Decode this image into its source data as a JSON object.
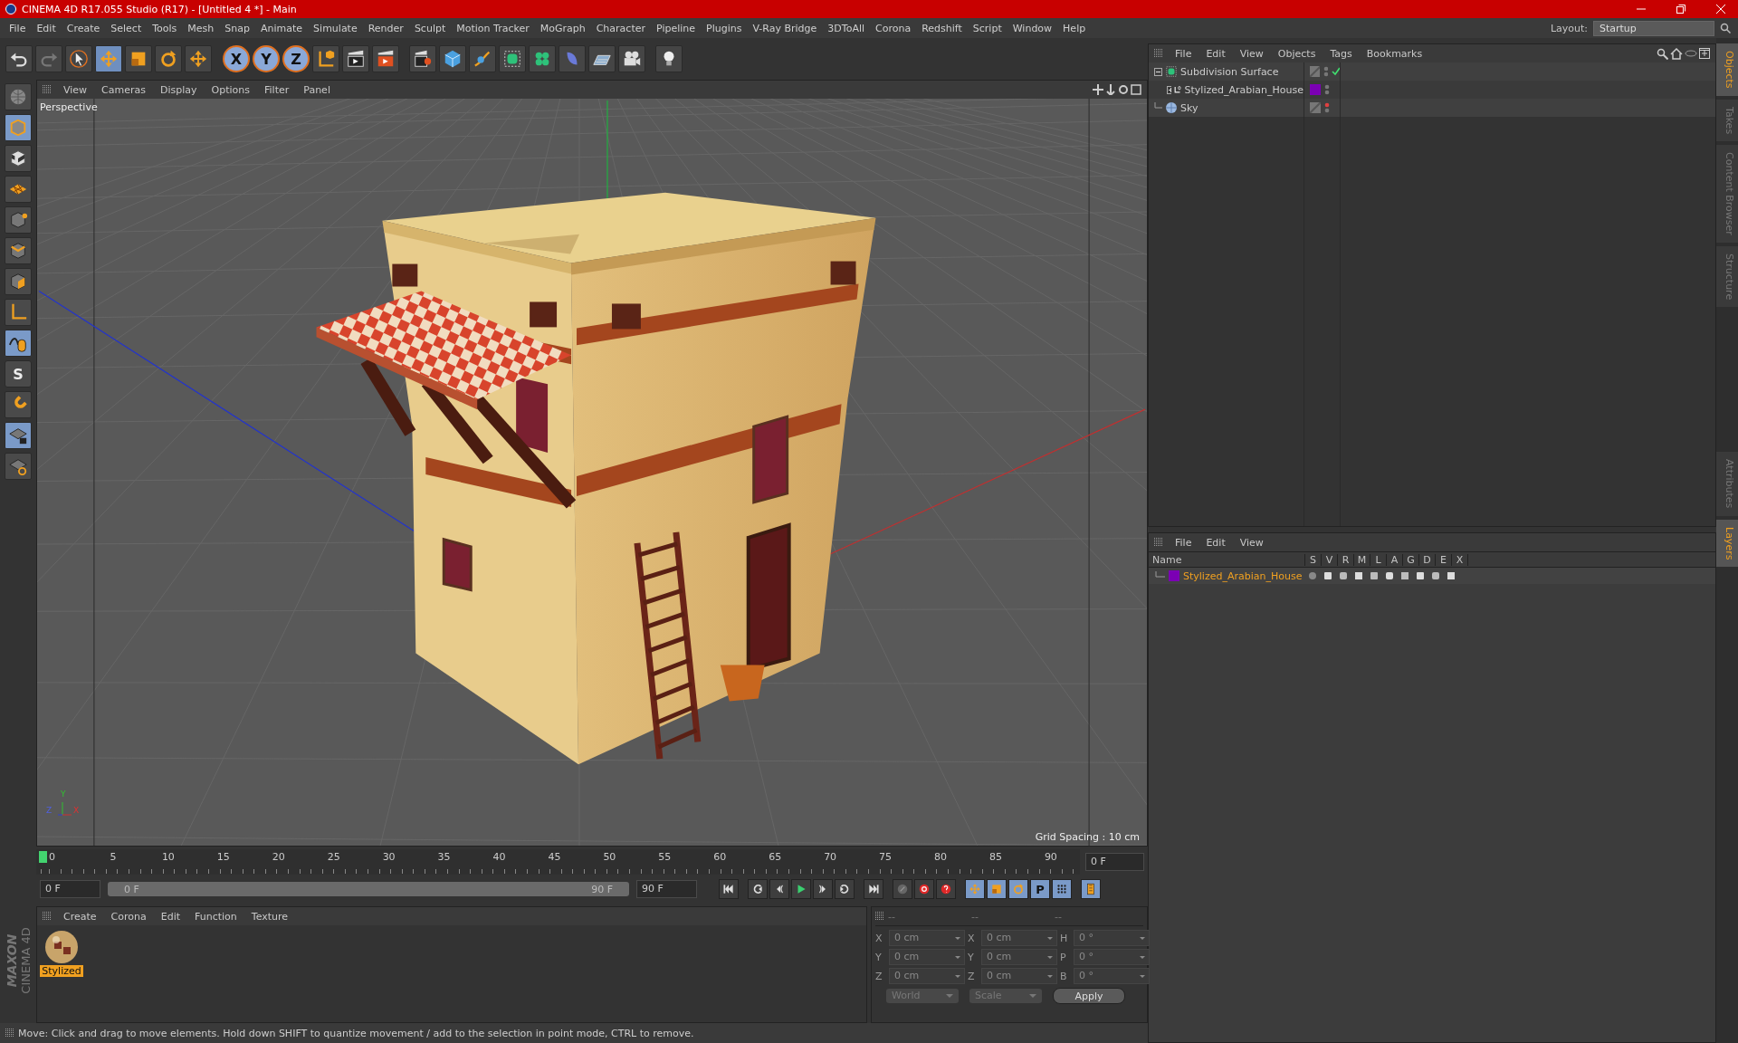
{
  "window": {
    "title": "CINEMA 4D R17.055 Studio (R17) - [Untitled 4 *] - Main"
  },
  "menu": [
    "File",
    "Edit",
    "Create",
    "Select",
    "Tools",
    "Mesh",
    "Snap",
    "Animate",
    "Simulate",
    "Render",
    "Sculpt",
    "Motion Tracker",
    "MoGraph",
    "Character",
    "Pipeline",
    "Plugins",
    "V-Ray Bridge",
    "3DToAll",
    "Corona",
    "Redshift",
    "Script",
    "Window",
    "Help"
  ],
  "layout": {
    "label": "Layout:",
    "value": "Startup"
  },
  "toolbar": {
    "axis_locks": [
      "X",
      "Y",
      "Z"
    ]
  },
  "left_palette": {
    "snap_letter": "S"
  },
  "viewport": {
    "menu": [
      "View",
      "Cameras",
      "Display",
      "Options",
      "Filter",
      "Panel"
    ],
    "camera": "Perspective",
    "grid_spacing": "Grid Spacing : 10 cm",
    "axes": [
      "Y",
      "Z",
      "X"
    ]
  },
  "timeline": {
    "ticks": [
      "0",
      "5",
      "10",
      "15",
      "20",
      "25",
      "30",
      "35",
      "40",
      "45",
      "50",
      "55",
      "60",
      "65",
      "70",
      "75",
      "80",
      "85",
      "90"
    ],
    "current_frame": "0 F",
    "start": "0 F",
    "range_start": "0 F",
    "range_end": "90 F",
    "range_slider": {
      "level": 1
    },
    "end": "90 F",
    "parameter_key": "P"
  },
  "material_manager": {
    "menu": [
      "Create",
      "Corona",
      "Edit",
      "Function",
      "Texture"
    ],
    "materials": [
      {
        "name": "Stylized",
        "selected": true
      }
    ]
  },
  "coordinates": {
    "headers": [
      "--",
      "--",
      "--"
    ],
    "rows": [
      [
        {
          "axis": "X",
          "value": "0 cm"
        },
        {
          "axis": "X",
          "value": "0 cm"
        },
        {
          "axis": "H",
          "value": "0 °"
        }
      ],
      [
        {
          "axis": "Y",
          "value": "0 cm"
        },
        {
          "axis": "Y",
          "value": "0 cm"
        },
        {
          "axis": "P",
          "value": "0 °"
        }
      ],
      [
        {
          "axis": "Z",
          "value": "0 cm"
        },
        {
          "axis": "Z",
          "value": "0 cm"
        },
        {
          "axis": "B",
          "value": "0 °"
        }
      ]
    ],
    "mode": "World",
    "size_mode": "Scale",
    "apply": "Apply"
  },
  "object_manager": {
    "menu": [
      "File",
      "Edit",
      "View",
      "Objects",
      "Tags",
      "Bookmarks"
    ],
    "objects": [
      {
        "name": "Subdivision Surface",
        "kind": "subdivision",
        "expanded": true,
        "enabled": true,
        "editor_visible": true,
        "children": [
          {
            "name": "Stylized_Arabian_House",
            "kind": "null",
            "expanded": false,
            "color": "#7b00b4",
            "editor_visible": true
          }
        ]
      },
      {
        "name": "Sky",
        "kind": "sky",
        "editor_visible": false
      }
    ]
  },
  "layer_manager": {
    "menu": [
      "File",
      "Edit",
      "View"
    ],
    "columns": [
      "Name",
      "S",
      "V",
      "R",
      "M",
      "L",
      "A",
      "G",
      "D",
      "E",
      "X"
    ],
    "layers": [
      {
        "name": "Stylized_Arabian_House",
        "color": "#7b00b4",
        "selected": true
      }
    ]
  },
  "side_tabs_top": [
    {
      "label": "Objects",
      "selected": true
    },
    {
      "label": "Takes",
      "selected": false
    },
    {
      "label": "Content Browser",
      "selected": false
    },
    {
      "label": "Structure",
      "selected": false
    }
  ],
  "side_tabs_bottom": [
    {
      "label": "Attributes",
      "selected": false
    },
    {
      "label": "Layers",
      "selected": true
    }
  ],
  "branding": [
    "MAXON",
    "CINEMA 4D"
  ],
  "status_bar": "Move: Click and drag to move elements. Hold down SHIFT to quantize movement / add to the selection in point mode, CTRL to remove."
}
